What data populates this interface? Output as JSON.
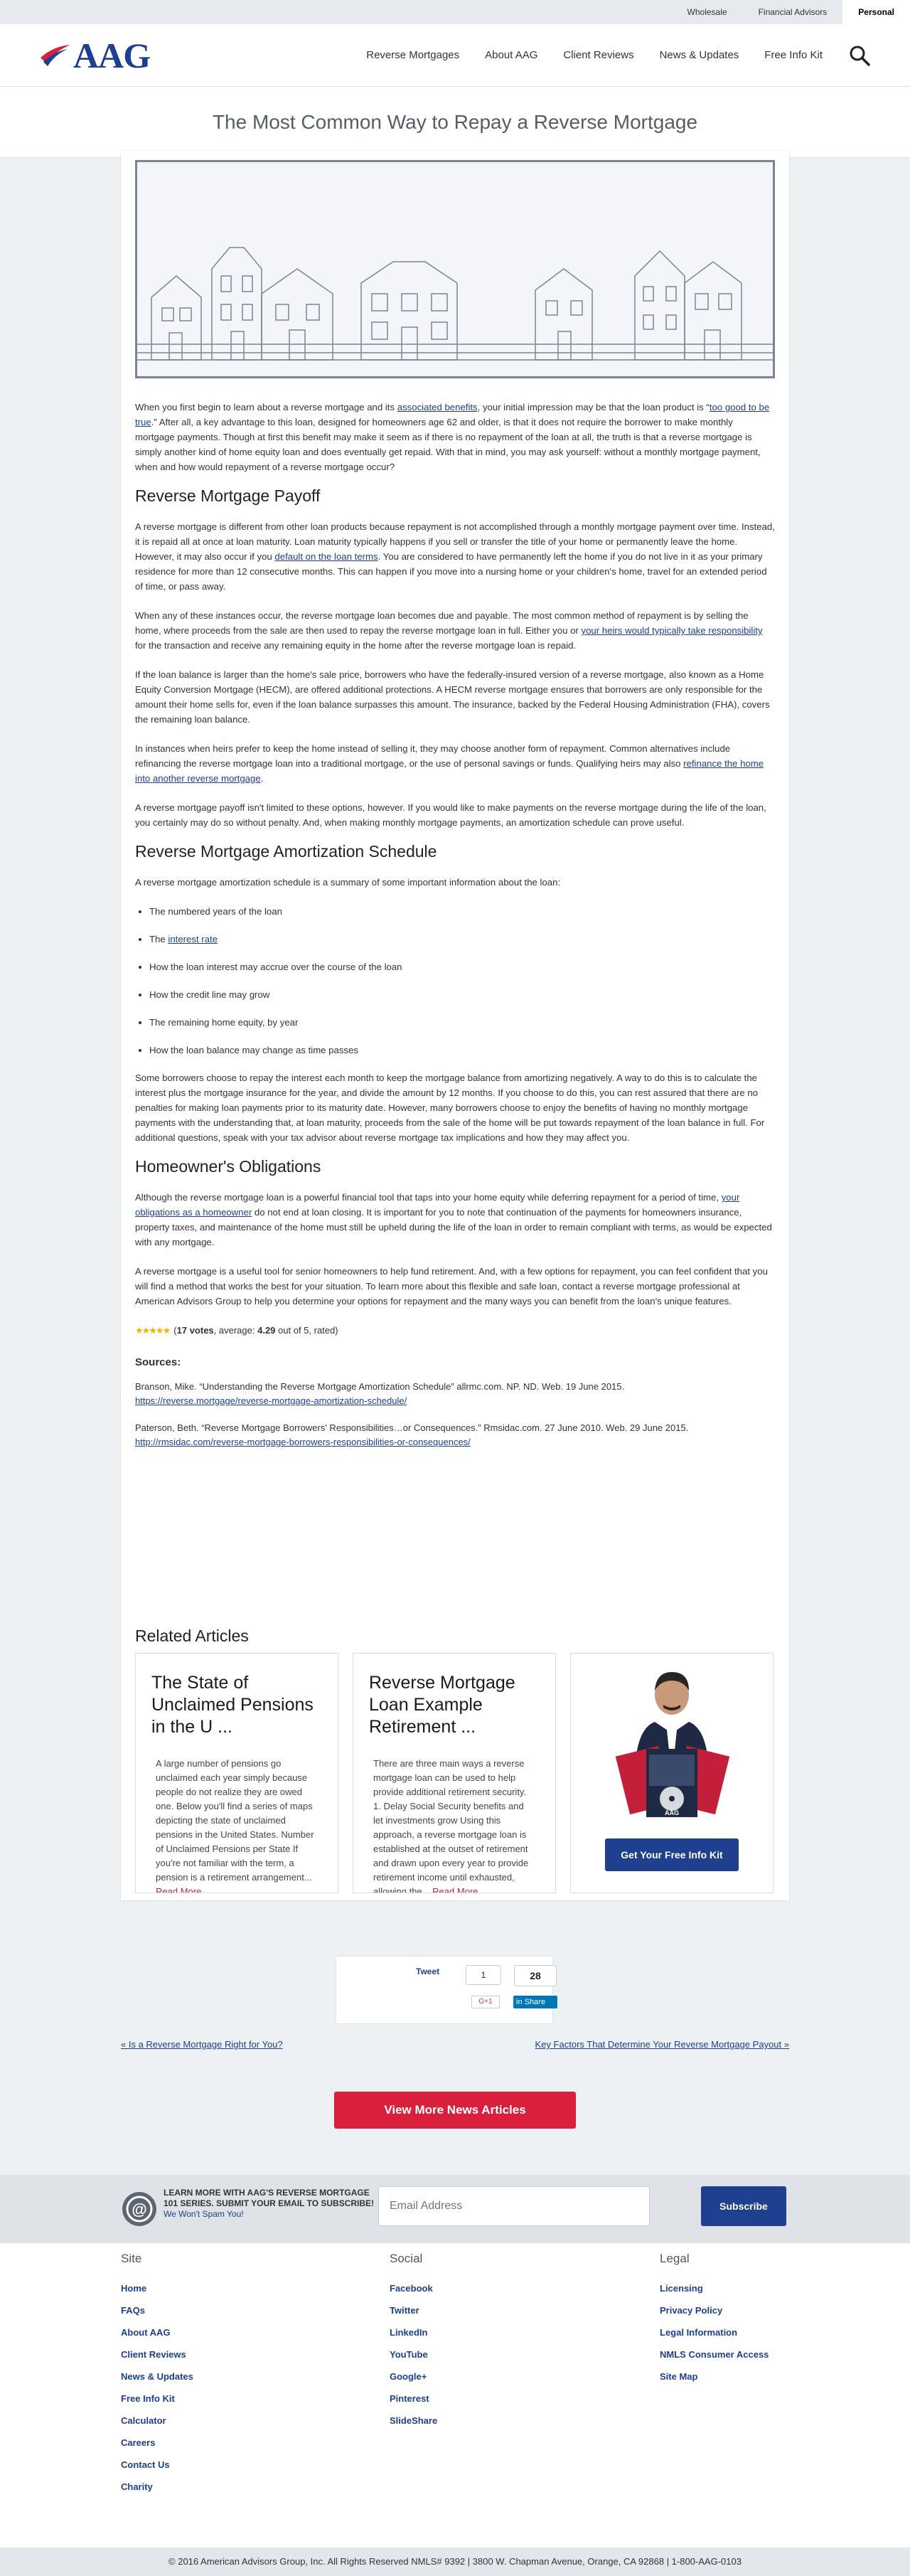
{
  "utility_bar": {
    "items": [
      "Wholesale",
      "Financial Advisors",
      "Personal"
    ]
  },
  "header": {
    "logo_text": "AAG",
    "nav": [
      "Reverse Mortgages",
      "About AAG",
      "Client Reviews",
      "News & Updates",
      "Free Info Kit"
    ],
    "search_icon": "search-icon"
  },
  "page_title": "The Most Common Way to Repay a Reverse Mortgage",
  "article": {
    "intro": {
      "p1_a": "When you first begin to learn about a reverse mortgage and its ",
      "p1_link1": "associated benefits",
      "p1_b": ", your initial impression may be that the loan product is “",
      "p1_link2": "too good to be true",
      "p1_c": ".”  After all, a key advantage to this loan, designed for homeowners age 62 and older, is that it does not require the borrower to make monthly mortgage payments.  Though at first this benefit may make it seem as if there is no repayment of the loan at all, the truth is that a reverse mortgage is simply another kind of home equity loan and does eventually get repaid.  With that in mind, you may ask yourself: without a monthly mortgage payment, when and how would repayment of a reverse mortgage occur?"
    },
    "h_payoff": "Reverse Mortgage Payoff",
    "payoff": {
      "p1_a": "A reverse mortgage is different from other loan products because repayment is not accomplished through a monthly mortgage payment over time.  Instead, it is repaid all at once at loan maturity.  Loan maturity typically happens if you sell or transfer the title of your home or permanently leave the home.  However, it may also occur if you ",
      "p1_link": "default on the loan terms",
      "p1_b": ".  You are considered to have permanently left the home if you do not live in it as your primary residence for more than 12 consecutive months.  This can happen if you move into a nursing home or your children's home, travel for an extended period of time, or pass away.",
      "p2_a": "When any of these instances occur, the reverse mortgage loan becomes due and payable.  The most common method of repayment is by selling the home, where proceeds from the sale are then used to repay the reverse mortgage loan in full.  Either you or ",
      "p2_link": "your heirs would typically take responsibility",
      "p2_b": " for the transaction and receive any remaining equity in the home after the reverse mortgage loan is repaid.",
      "p3": "If the loan balance is larger than the home's sale price, borrowers who have the federally-insured version of a reverse mortgage, also known as a Home Equity Conversion Mortgage (HECM), are offered additional protections.  A HECM reverse mortgage ensures that borrowers are only responsible for the amount their home sells for, even if the loan balance surpasses this amount.  The insurance, backed by the Federal Housing Administration (FHA), covers the remaining loan balance.",
      "p4_a": "In instances when heirs prefer to keep the home instead of selling it, they may choose another form of repayment.  Common alternatives include refinancing the reverse mortgage loan into a traditional mortgage, or the use of personal savings or funds.  Qualifying heirs may also ",
      "p4_link": "refinance the home into another reverse mortgage",
      "p4_b": ".",
      "p5": "A reverse mortgage payoff isn't limited to these options, however.  If you would like to make payments on the reverse mortgage during the life of the loan, you certainly may do so without penalty.  And, when making monthly mortgage payments, an amortization schedule can prove useful."
    },
    "h_amort": "Reverse Mortgage Amortization Schedule",
    "amort": {
      "p1": "A reverse mortgage amortization schedule is a summary of some important information about the loan:",
      "li1": "The numbered years of the loan",
      "li2_a": "The ",
      "li2_link": "interest rate",
      "li3": "How the loan interest may accrue over the course of the loan",
      "li4": "How the credit line may grow",
      "li5": "The remaining home equity, by year",
      "li6": "How the loan balance may change as time passes",
      "p2": "Some borrowers choose to repay the interest each month to keep the mortgage balance from amortizing negatively.  A way to do this is to calculate the interest plus the mortgage insurance for the year, and divide the amount by 12 months.  If you choose to do this, you can rest assured that there are no penalties for making loan payments prior to its maturity date.  However, many borrowers choose to enjoy the benefits of having no monthly mortgage payments with the understanding that, at loan maturity, proceeds from the sale of the home will be put towards repayment of the loan balance in full. For additional questions, speak with your tax advisor about reverse mortgage tax implications and how they may affect you."
    },
    "h_oblig": "Homeowner's Obligations",
    "oblig": {
      "p1_a": "Although the reverse mortgage loan is a powerful financial tool that taps into your home equity while deferring repayment for a period of time, ",
      "p1_link": "your obligations as a homeowner",
      "p1_b": " do not end at loan closing.  It is important for you to note that continuation of the payments for homeowners insurance, property taxes, and maintenance of the home must still be upheld during the life of the loan in order to remain compliant with terms, as would be expected with any mortgage.",
      "p2": "A reverse mortgage is a useful tool for senior homeowners to help fund retirement. And, with a few options for repayment, you can feel confident that you will find a method that works the best for your situation.  To learn more about this flexible and safe loan, contact a reverse mortgage professional at American Advisors Group to help you determine your options for repayment and the many ways you can benefit from the loan's unique features."
    },
    "rating": {
      "stars": "★★★★★",
      "votes": "17 votes",
      "text_a": "(",
      "text_b": ", average: ",
      "average": "4.29",
      "text_c": " out of 5, rated)"
    },
    "sources_title": "Sources:",
    "sources": [
      {
        "text": "Branson, Mike.  “Understanding the Reverse Mortgage Amortization Schedule” allrmc.com. NP. ND. Web. 19 June 2015.",
        "url": "https://reverse.mortgage/reverse-mortgage-amortization-schedule/"
      },
      {
        "text": "Paterson, Beth. “Reverse Mortgage Borrowers' Responsibilities…or Consequences.” Rmsidac.com. 27 June 2010. Web. 29 June 2015.",
        "url": "http://rmsidac.com/reverse-mortgage-borrowers-responsibilities-or-consequences/"
      }
    ]
  },
  "related": {
    "title": "Related Articles",
    "cards": [
      {
        "title": "The State of Unclaimed Pensions in the U ...",
        "excerpt": "A large number of pensions go unclaimed each year simply because people do not realize they are owed one. Below you'll find a series of maps depicting the state of unclaimed pensions in the United States. Number of Unclaimed Pensions per State If you're not familiar with the term, a pension is a retirement arrangement...",
        "more": "Read More"
      },
      {
        "title": "Reverse Mortgage Loan Example Retirement ...",
        "excerpt": "There are three main ways a reverse mortgage loan can be used to help provide additional retirement security.   1. Delay Social Security benefits and let investments grow Using this approach, a reverse mortgage loan is established at the outset of retirement and drawn upon every year to provide retirement income until exhausted, allowing the...",
        "more": "Read More"
      }
    ],
    "promo_button": "Get Your Free Info Kit",
    "promo_kit_label": "AAG"
  },
  "share": {
    "tweet": "Tweet",
    "tweet_count": "1",
    "lin_count": "28",
    "gplus": "G+1",
    "linkedin": "in Share"
  },
  "prev_link": "« Is a Reverse Mortgage Right for You?",
  "next_link": "Key Factors That Determine Your Reverse Mortgage Payout »",
  "more_news_button": "View More News Articles",
  "newsletter": {
    "line1": "LEARN MORE WITH AAG'S REVERSE MORTGAGE",
    "line2": "101 SERIES. SUBMIT YOUR EMAIL TO SUBSCRIBE!",
    "line3": "We Won't Spam You!",
    "placeholder": "Email Address",
    "button": "Subscribe"
  },
  "footer": {
    "site_title": "Site",
    "site_links": [
      "Home",
      "FAQs",
      "About AAG",
      "Client Reviews",
      "News & Updates",
      "Free Info Kit",
      "Calculator",
      "Careers",
      "Contact Us",
      "Charity"
    ],
    "social_title": "Social",
    "social_links": [
      "Facebook",
      "Twitter",
      "LinkedIn",
      "YouTube",
      "Google+",
      "Pinterest",
      "SlideShare"
    ],
    "legal_title": "Legal",
    "legal_links": [
      "Licensing",
      "Privacy Policy",
      "Legal Information",
      "NMLS Consumer Access",
      "Site Map"
    ],
    "copyright": "© 2016 American Advisors Group, Inc. All Rights Reserved NMLS# 9392 | 3800 W. Chapman Avenue, Orange, CA 92868 | 1-800-AAG-0103"
  },
  "colors": {
    "brand_blue": "#1d3f8f",
    "brand_red": "#d91f3b",
    "link": "#1d3f8f"
  }
}
